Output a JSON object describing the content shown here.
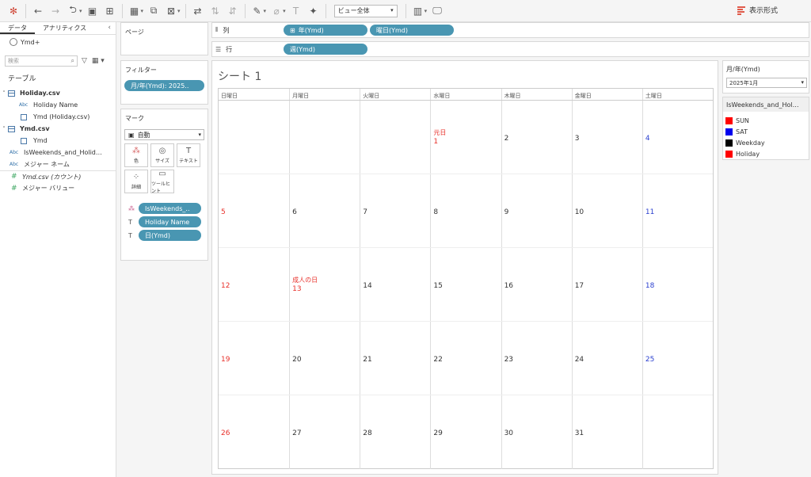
{
  "toolbar": {
    "view_select": "ビュー全体",
    "show_me": "表示形式"
  },
  "datapane": {
    "tab_data": "データ",
    "tab_analytics": "アナリティクス",
    "datasource": "Ymd+",
    "search_placeholder": "検索",
    "tables_header": "テーブル",
    "fields": [
      {
        "label": "Holiday.csv",
        "type": "table"
      },
      {
        "label": "Holiday Name",
        "type": "abc"
      },
      {
        "label": "Ymd (Holiday.csv)",
        "type": "date"
      },
      {
        "label": "Ymd.csv",
        "type": "table"
      },
      {
        "label": "Ymd",
        "type": "date"
      },
      {
        "label": "IsWeekends_and_Holid…",
        "type": "abc"
      },
      {
        "label": "メジャー ネーム",
        "type": "abc"
      },
      {
        "label": "Ymd.csv (カウント)",
        "type": "measure"
      },
      {
        "label": "メジャー バリュー",
        "type": "measure"
      }
    ]
  },
  "pages": {
    "title": "ページ"
  },
  "filters": {
    "title": "フィルター",
    "pill": "月/年(Ymd): 2025.."
  },
  "marks": {
    "title": "マーク",
    "type": "自動",
    "buttons": [
      "色",
      "サイズ",
      "テキスト",
      "詳細",
      "ツールヒント"
    ],
    "pills": [
      "IsWeekends_..",
      "Holiday Name",
      "日(Ymd)"
    ]
  },
  "columns": {
    "label": "列",
    "pills": [
      "年(Ymd)",
      "曜日(Ymd)"
    ]
  },
  "rows": {
    "label": "行",
    "pills": [
      "週(Ymd)"
    ]
  },
  "sheet": {
    "title": "シート 1",
    "weekdays": [
      "日曜日",
      "月曜日",
      "火曜日",
      "水曜日",
      "木曜日",
      "金曜日",
      "土曜日"
    ],
    "weeks": [
      [
        {
          "d": ""
        },
        {
          "d": ""
        },
        {
          "d": ""
        },
        {
          "d": "1",
          "h": "元日",
          "c": "holiday"
        },
        {
          "d": "2",
          "c": "weekday"
        },
        {
          "d": "3",
          "c": "weekday"
        },
        {
          "d": "4",
          "c": "sat"
        }
      ],
      [
        {
          "d": "5",
          "c": "sun"
        },
        {
          "d": "6",
          "c": "weekday"
        },
        {
          "d": "7",
          "c": "weekday"
        },
        {
          "d": "8",
          "c": "weekday"
        },
        {
          "d": "9",
          "c": "weekday"
        },
        {
          "d": "10",
          "c": "weekday"
        },
        {
          "d": "11",
          "c": "sat"
        }
      ],
      [
        {
          "d": "12",
          "c": "sun"
        },
        {
          "d": "13",
          "h": "成人の日",
          "c": "holiday"
        },
        {
          "d": "14",
          "c": "weekday"
        },
        {
          "d": "15",
          "c": "weekday"
        },
        {
          "d": "16",
          "c": "weekday"
        },
        {
          "d": "17",
          "c": "weekday"
        },
        {
          "d": "18",
          "c": "sat"
        }
      ],
      [
        {
          "d": "19",
          "c": "sun"
        },
        {
          "d": "20",
          "c": "weekday"
        },
        {
          "d": "21",
          "c": "weekday"
        },
        {
          "d": "22",
          "c": "weekday"
        },
        {
          "d": "23",
          "c": "weekday"
        },
        {
          "d": "24",
          "c": "weekday"
        },
        {
          "d": "25",
          "c": "sat"
        }
      ],
      [
        {
          "d": "26",
          "c": "sun"
        },
        {
          "d": "27",
          "c": "weekday"
        },
        {
          "d": "28",
          "c": "weekday"
        },
        {
          "d": "29",
          "c": "weekday"
        },
        {
          "d": "30",
          "c": "weekday"
        },
        {
          "d": "31",
          "c": "weekday"
        },
        {
          "d": ""
        }
      ]
    ]
  },
  "colors": {
    "sun": "#e8302a",
    "sat": "#2a3fcf",
    "weekday": "#333333",
    "holiday": "#e8302a",
    "pill": "#4996b2"
  },
  "month_filter": {
    "title": "月/年(Ymd)",
    "value": "2025年1月"
  },
  "legend": {
    "title": "IsWeekends_and_Hol…",
    "items": [
      {
        "label": "SUN",
        "color": "#ff0000"
      },
      {
        "label": "SAT",
        "color": "#0000ee"
      },
      {
        "label": "Weekday",
        "color": "#000000"
      },
      {
        "label": "Holiday",
        "color": "#ff0000"
      }
    ]
  }
}
